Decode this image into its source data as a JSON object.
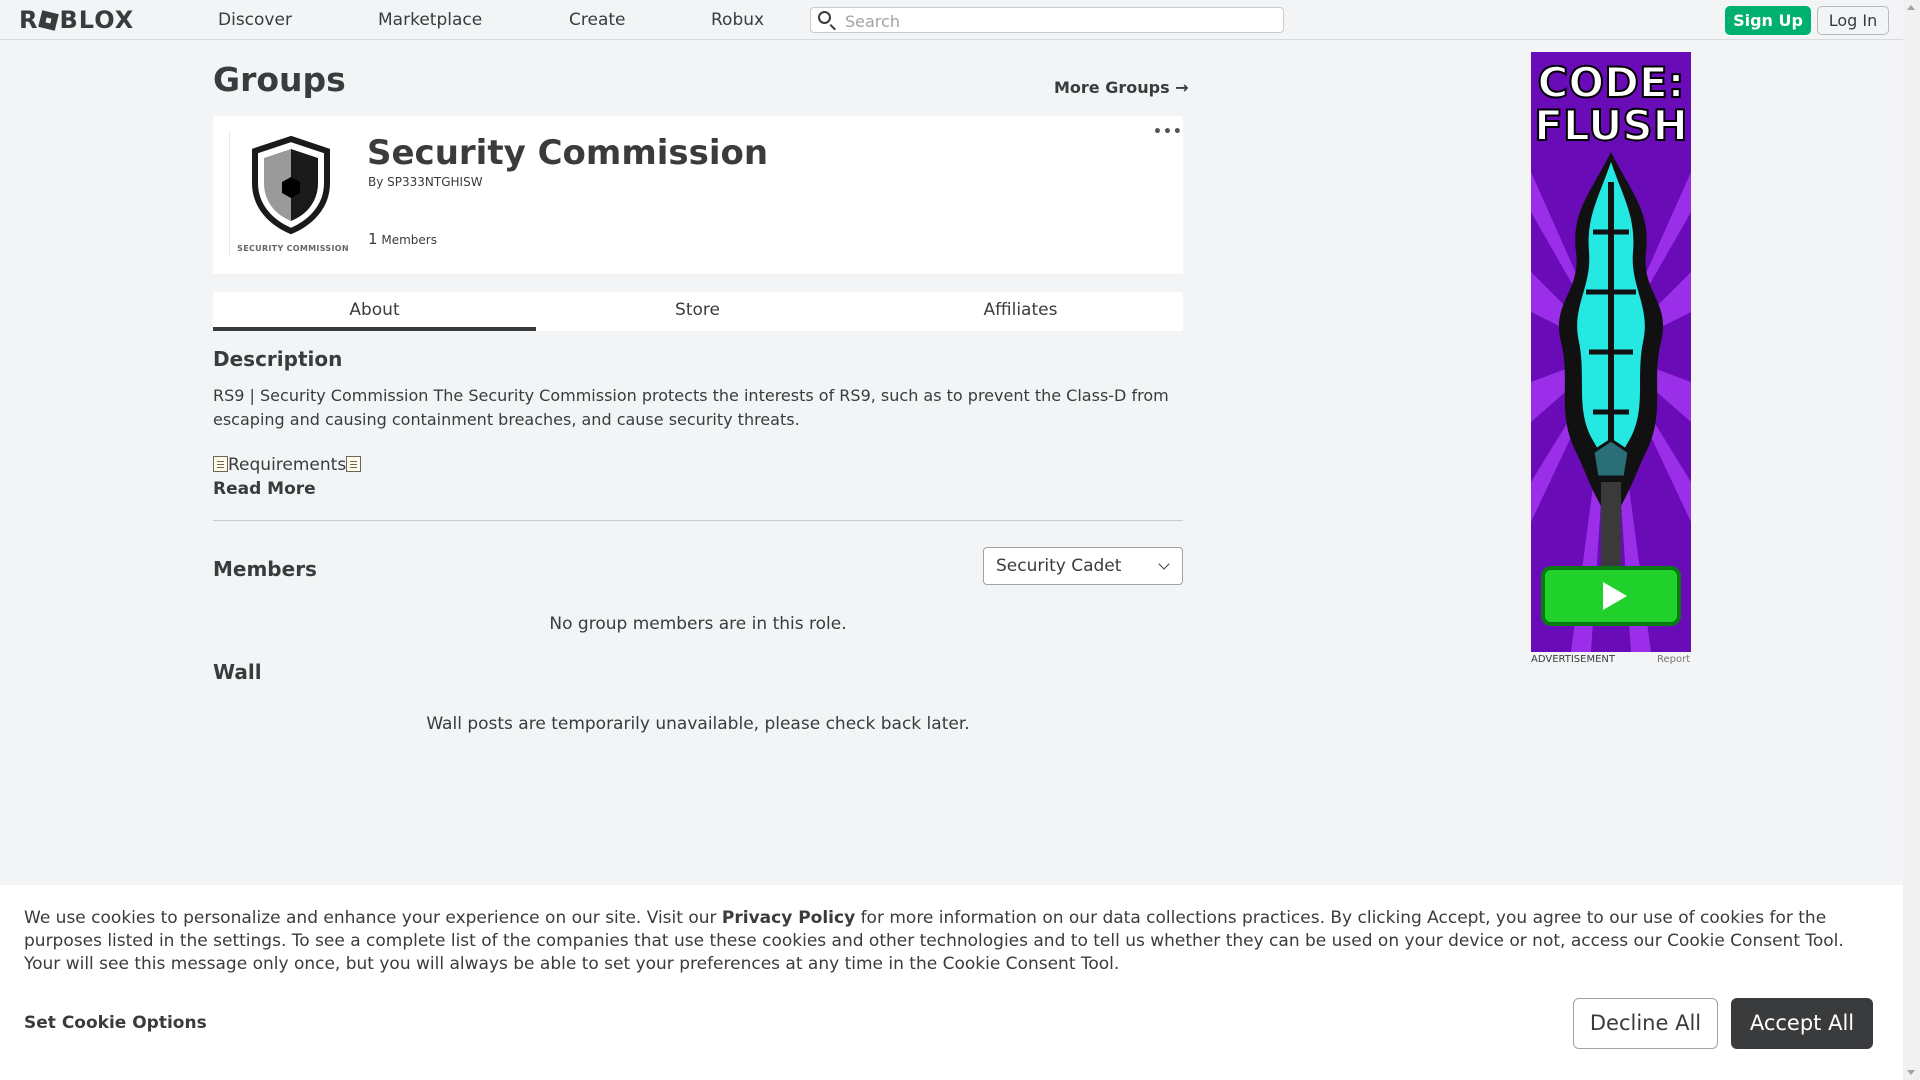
{
  "nav": {
    "logo": "ROBLOX",
    "links": [
      "Discover",
      "Marketplace",
      "Create",
      "Robux"
    ],
    "search_placeholder": "Search",
    "signup": "Sign Up",
    "login": "Log In"
  },
  "page": {
    "title": "Groups",
    "more_groups": "More Groups →"
  },
  "group": {
    "name": "Security Commission",
    "by_label": "By",
    "owner": "SP333NTGHISW",
    "member_count": "1",
    "member_label": "Members",
    "emblem_caption": "SECURITY COMMISSION",
    "more_menu": "•••"
  },
  "tabs": [
    "About",
    "Store",
    "Affiliates"
  ],
  "about": {
    "description_heading": "Description",
    "description": "RS9 | Security Commission The Security Commission protects the interests of RS9, such as to prevent the Class-D from escaping and causing containment breaches, and cause security threats.",
    "requirements": "Requirements",
    "read_more": "Read More",
    "members_heading": "Members",
    "role_selected": "Security Cadet",
    "members_empty": "No group members are in this role.",
    "wall_heading": "Wall",
    "wall_empty": "Wall posts are temporarily unavailable, please check back later."
  },
  "ad": {
    "title_line1": "CODE:",
    "title_line2": "FLUSH",
    "label": "ADVERTISEMENT",
    "report": "Report",
    "colors": {
      "purple": "#7a10c9",
      "cyan": "#25e8e3",
      "green": "#21d12b"
    }
  },
  "cookie": {
    "text_before_link": "We use cookies to personalize and enhance your experience on our site. Visit our ",
    "privacy_link": "Privacy Policy",
    "text_after_link": " for more information on our data collections practices. By clicking Accept, you agree to our use of cookies for the purposes listed in the settings. To see a complete list of the companies that use these cookies and other technologies and to tell us whether they can be used on your device or not, access our Cookie Consent Tool. Your will see this message only once, but you will always be able to set your preferences at any time in the Cookie Consent Tool.",
    "set_options": "Set Cookie Options",
    "decline": "Decline All",
    "accept": "Accept All"
  },
  "colors": {
    "accent_green": "#00b06f",
    "text": "#393b3d",
    "background": "#f2f4f5"
  }
}
